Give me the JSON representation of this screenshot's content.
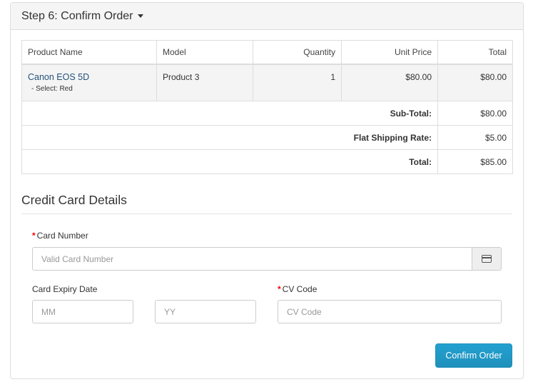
{
  "panel": {
    "title": "Step 6: Confirm Order"
  },
  "table": {
    "headers": {
      "product": "Product Name",
      "model": "Model",
      "quantity": "Quantity",
      "unit_price": "Unit Price",
      "total": "Total"
    },
    "item": {
      "name": "Canon EOS 5D",
      "option": "- Select: Red",
      "model": "Product 3",
      "quantity": "1",
      "unit_price": "$80.00",
      "total": "$80.00"
    },
    "totals": [
      {
        "label": "Sub-Total:",
        "value": "$80.00"
      },
      {
        "label": "Flat Shipping Rate:",
        "value": "$5.00"
      },
      {
        "label": "Total:",
        "value": "$85.00"
      }
    ]
  },
  "credit_card": {
    "title": "Credit Card Details",
    "required_mark": "*",
    "card_number_label": "Card Number",
    "card_number_placeholder": "Valid Card Number",
    "card_icon": "credit-card-icon",
    "expiry_label": "Card Expiry Date",
    "month_placeholder": "MM",
    "year_placeholder": "YY",
    "cv_label": "CV Code",
    "cv_placeholder": "CV Code"
  },
  "confirm_button": "Confirm Order",
  "colors": {
    "button": "#229ac8",
    "link": "#23527c",
    "required": "#ff0000"
  }
}
